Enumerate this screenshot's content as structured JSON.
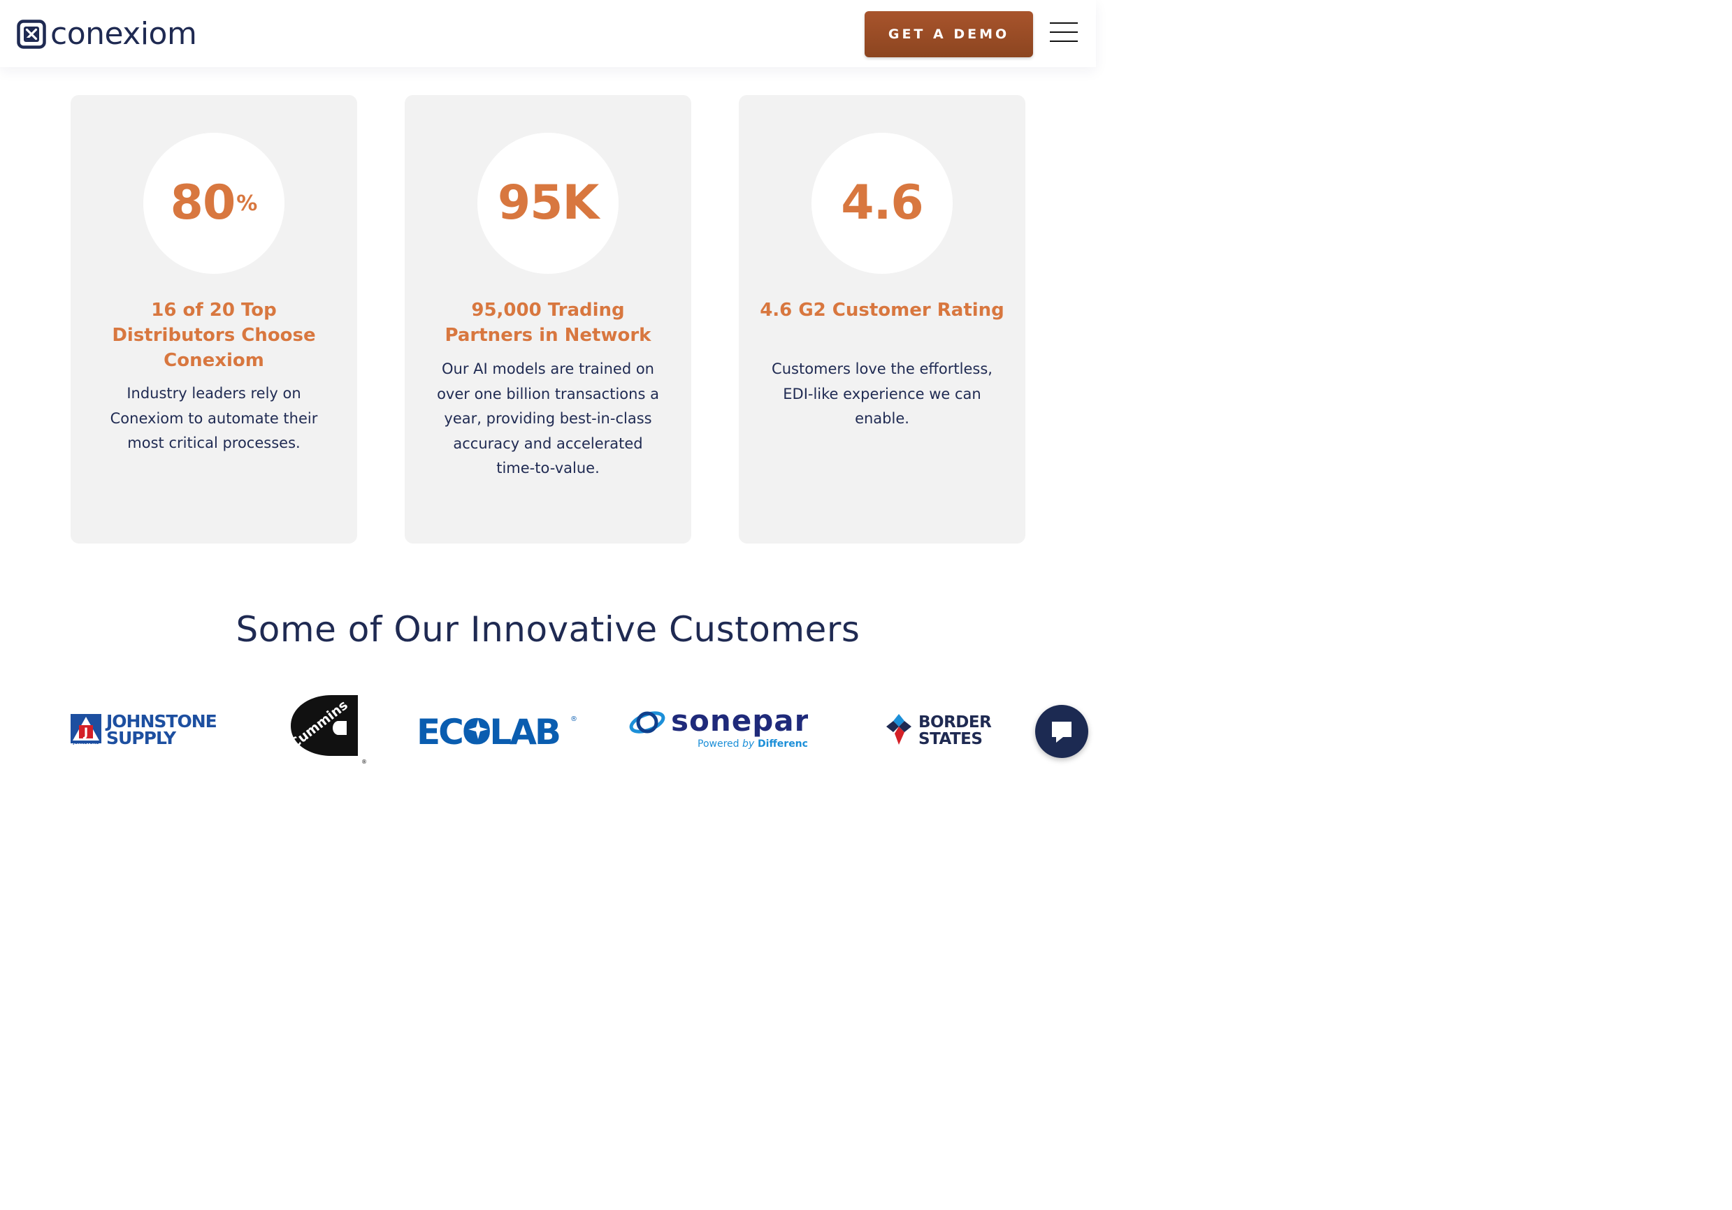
{
  "header": {
    "logo_text": "conexiom",
    "logo_icon": "conexiom-x-logo-icon",
    "cta_label": "GET A DEMO",
    "menu_icon": "hamburger-menu-icon"
  },
  "colors": {
    "navy": "#1f2a52",
    "accent_orange": "#d8773f",
    "button_brown": "#9a4b25",
    "card_bg": "#f2f2f2"
  },
  "stats": [
    {
      "number": "80",
      "suffix": "%",
      "title": "16 of 20 Top Distributors  Choose Conexiom",
      "text": "Industry leaders rely on Conexiom to automate their most critical processes."
    },
    {
      "number": "95K",
      "suffix": "",
      "title": "95,000 Trading Partners in Network",
      "text": "Our AI models are trained on over one billion transactions a year, providing best-in-class accuracy and accelerated time-to-value."
    },
    {
      "number": "4.6",
      "suffix": "",
      "title": "4.6 G2 Customer Rating",
      "text": "Customers love the effortless, EDI-like experience we can enable."
    }
  ],
  "customers": {
    "heading": "Some of Our Innovative Customers",
    "logos": [
      {
        "name": "johnstone-supply",
        "line1": "JOHNSTONE",
        "line2": "SUPPLY",
        "badge_text": "JOHNSTONE",
        "badge_letter": "J"
      },
      {
        "name": "cummins",
        "text": "Cummins",
        "mark": "®"
      },
      {
        "name": "ecolab",
        "text": "ECOLAB",
        "mark": "®"
      },
      {
        "name": "sonepar",
        "text": "sonepar",
        "tagline_prefix": "Powered ",
        "tagline_by": "by",
        "tagline_suffix": " Difference"
      },
      {
        "name": "border-states",
        "line1": "BORDER",
        "line2": "STATES"
      }
    ]
  },
  "chat": {
    "icon": "chat-bubble-icon"
  }
}
